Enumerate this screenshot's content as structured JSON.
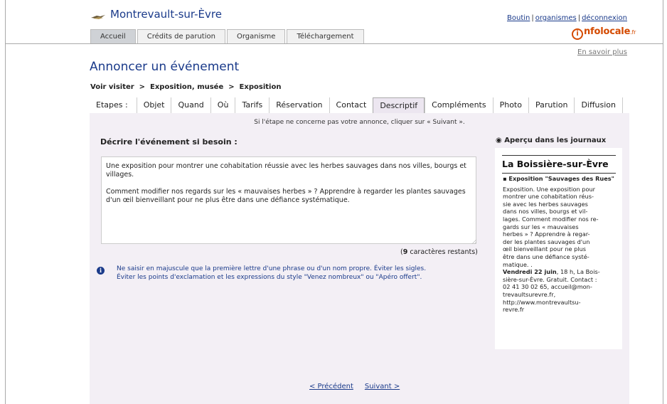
{
  "site": {
    "name": "Montrevault-sur-Èvre"
  },
  "top_links": {
    "user": "Boutin",
    "sep": "|",
    "organisations": "organismes",
    "logout": "déconnexion"
  },
  "brand": {
    "letter": "i",
    "name": "nfolocale",
    "suffix": ".fr",
    "color": "#d44a00"
  },
  "nav_tabs": [
    {
      "label": "Accueil",
      "active": true
    },
    {
      "label": "Crédits de parution",
      "active": false
    },
    {
      "label": "Organisme",
      "active": false
    },
    {
      "label": "Téléchargement",
      "active": false
    }
  ],
  "learn_more": "En savoir plus",
  "page_title": "Annoncer un événement",
  "breadcrumb": "Voir visiter  >  Exposition, musée  >  Exposition",
  "steps": {
    "label": "Etapes :",
    "items": [
      "Objet",
      "Quand",
      "Où",
      "Tarifs",
      "Réservation",
      "Contact",
      "Descriptif",
      "Compléments",
      "Photo",
      "Parution",
      "Diffusion"
    ],
    "active": "Descriptif"
  },
  "hint": "Si l'étape ne concerne pas votre annonce, cliquer sur « Suivant ».",
  "field_label": "Décrire l'événement si besoin :",
  "description": "Une exposition pour montrer une cohabitation réussie avec les herbes sauvages dans nos villes, bourgs et villages.\n\nComment modifier nos regards sur les « mauvaises herbes » ? Apprendre à regarder les plantes sauvages d'un œil bienveillant pour ne plus être dans une défiance systématique.",
  "counter": {
    "open": "(",
    "count": "9",
    "rest": " caractères restants)"
  },
  "info": {
    "line1": "Ne saisir en majuscule que la première lettre d'une phrase ou d'un nom propre. Éviter les sigles.",
    "line2": "Éviter les points d'exclamation et les expressions du style \"Venez nombreux\" ou \"Apéro offert\"."
  },
  "preview": {
    "label": "◉ Aperçu dans les journaux",
    "town": "La Boissière-sur-Èvre",
    "heading": "▪ Exposition \"Sauvages des Rues\"",
    "lines": [
      "Exposition. Une exposition pour",
      "montrer une cohabitation réus-",
      "sie avec les herbes sauvages",
      "dans nos villes, bourgs et vil-",
      "lages. Comment modifier nos re-",
      "gards sur les « mauvaises",
      "herbes » ? Apprendre à regar-",
      "der les plantes sauvages d'un",
      "œil bienveillant pour ne plus",
      "être dans une défiance systé-",
      "matique. ."
    ],
    "date_bold": "Vendredi 22 juin",
    "date_rest": ", 18 h, La Bois-",
    "lines2": [
      "sière-sur-Èvre. Gratuit. Contact :",
      "02 41 30 02 65, accueil@mon-",
      "trevaultsurevre.fr,",
      "http://www.montrevaultsu-",
      "revre.fr"
    ]
  },
  "pager": {
    "prev": "< Précédent",
    "next": "Suivant >"
  }
}
